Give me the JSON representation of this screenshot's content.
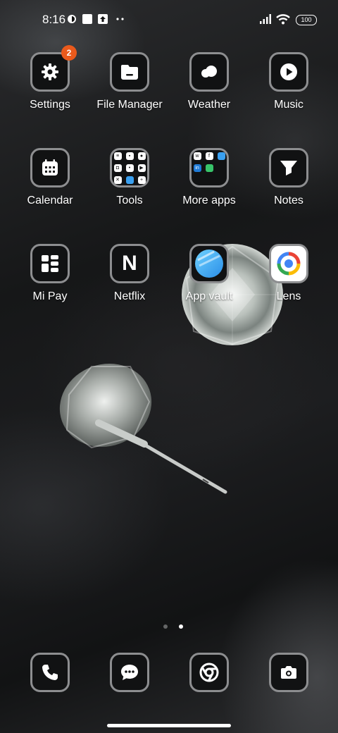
{
  "status_bar": {
    "time": "8:16",
    "battery": "100",
    "icons": [
      "vpn-icon",
      "square-notification-icon",
      "upload-icon",
      "more-dots-icon",
      "signal-icon",
      "wifi-icon",
      "battery-icon"
    ]
  },
  "apps": [
    {
      "label": "Settings",
      "icon": "gear-icon",
      "badge": "2"
    },
    {
      "label": "File Manager",
      "icon": "folder-icon"
    },
    {
      "label": "Weather",
      "icon": "cloud-icon"
    },
    {
      "label": "Music",
      "icon": "play-icon"
    },
    {
      "label": "Calendar",
      "icon": "calendar-icon"
    },
    {
      "label": "Tools",
      "icon": "folder-tools-icon"
    },
    {
      "label": "More apps",
      "icon": "folder-more-apps-icon"
    },
    {
      "label": "Notes",
      "icon": "notes-icon"
    },
    {
      "label": "Mi Pay",
      "icon": "mi-pay-icon"
    },
    {
      "label": "Netflix",
      "icon": "netflix-icon",
      "glyph": "N"
    },
    {
      "label": "App vault",
      "icon": "app-vault-icon"
    },
    {
      "label": "Lens",
      "icon": "lens-icon"
    }
  ],
  "dock": [
    {
      "icon": "phone-icon"
    },
    {
      "icon": "messages-icon"
    },
    {
      "icon": "chrome-icon"
    },
    {
      "icon": "camera-icon"
    }
  ],
  "pages": {
    "count": 2,
    "active": 2
  },
  "colors": {
    "badge": "#ea5a1c",
    "icon_border": "#8d8e90",
    "icon_bg": "#111213"
  }
}
